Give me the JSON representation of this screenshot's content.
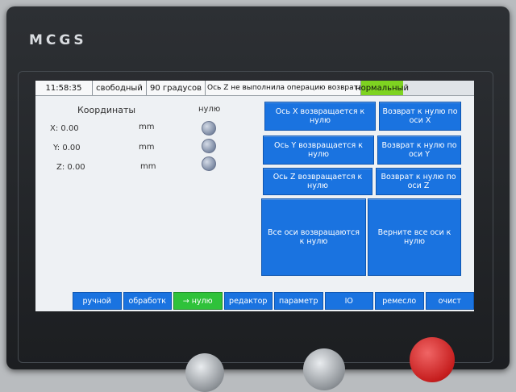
{
  "brand": "MCGS",
  "status": {
    "time": "11:58:35",
    "mode": "свободный",
    "angle": "90 градусов",
    "message": "Ось Z не выполнила операцию возврата к нулю",
    "state": "нормальный",
    "state_color": "#7ed321"
  },
  "coordinates": {
    "title": "Координаты",
    "home_title": "нулю",
    "rows": [
      {
        "label": "X: 0.00",
        "unit": "mm"
      },
      {
        "label": "Y: 0.00",
        "unit": "mm"
      },
      {
        "label": "Z: 0.00",
        "unit": "mm"
      }
    ]
  },
  "actions": {
    "x_home": "Ось X возвращается к нулю",
    "x_home_axis": "Возврат к нулю по оси X",
    "y_home": "Ось Y возвращается к нулю",
    "y_home_axis": "Возврат к нулю по оси Y",
    "z_home": "Ось Z возвращается к нулю",
    "z_home_axis": "Возврат к нулю по оси Z",
    "all_home": "Все оси возвращаются к нулю",
    "all_return": "Верните все оси к нулю"
  },
  "tabs": [
    {
      "label": "ручной"
    },
    {
      "label": "обработк"
    },
    {
      "label": "→ нулю"
    },
    {
      "label": "редактор"
    },
    {
      "label": "параметр"
    },
    {
      "label": "IO"
    },
    {
      "label": "ремесло"
    },
    {
      "label": "очист"
    }
  ],
  "colors": {
    "button_blue": "#1a73e0",
    "tab_active": "#2fc23a",
    "screen_bg": "#eef1f4"
  }
}
